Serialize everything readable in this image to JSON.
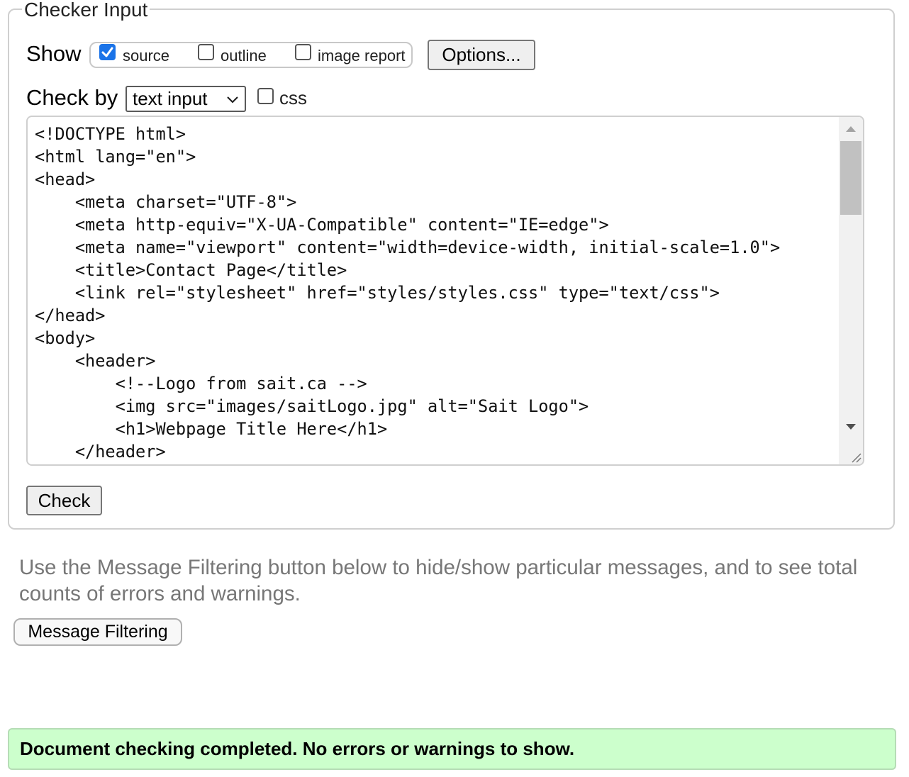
{
  "checker": {
    "legend": "Checker Input",
    "show_label": "Show",
    "show_options": [
      {
        "label": "source",
        "checked": true
      },
      {
        "label": "outline",
        "checked": false
      },
      {
        "label": "image report",
        "checked": false
      }
    ],
    "options_button": "Options...",
    "check_by_label": "Check by",
    "check_by_selected": "text input",
    "css_label": "css",
    "css_checked": false,
    "source_text": "<!DOCTYPE html>\n<html lang=\"en\">\n<head>\n    <meta charset=\"UTF-8\">\n    <meta http-equiv=\"X-UA-Compatible\" content=\"IE=edge\">\n    <meta name=\"viewport\" content=\"width=device-width, initial-scale=1.0\">\n    <title>Contact Page</title>\n    <link rel=\"stylesheet\" href=\"styles/styles.css\" type=\"text/css\">\n</head>\n<body>\n    <header>\n        <!--Logo from sait.ca -->\n        <img src=\"images/saitLogo.jpg\" alt=\"Sait Logo\">\n        <h1>Webpage Title Here</h1>\n    </header>",
    "check_button": "Check"
  },
  "filter": {
    "info_text": "Use the Message Filtering button below to hide/show particular messages, and to see total counts of errors and warnings.",
    "button_label": "Message Filtering"
  },
  "status": {
    "message": "Document checking completed. No errors or warnings to show.",
    "color": "#ccffcc"
  },
  "colors": {
    "checkbox_accent": "#1a73e8",
    "info_text": "#777777"
  }
}
